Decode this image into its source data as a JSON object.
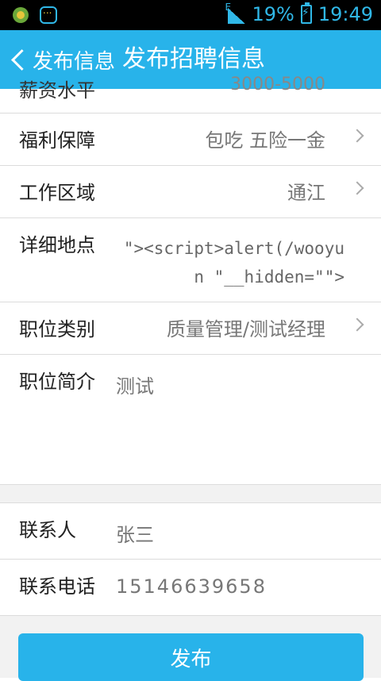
{
  "status_bar": {
    "network": "E",
    "battery": "19%",
    "time": "19:49"
  },
  "header": {
    "back_label": "发布信息",
    "title": "发布招聘信息"
  },
  "partial_row": {
    "label": "薪资水平",
    "value": "3000-5000"
  },
  "rows": {
    "welfare": {
      "label": "福利保障",
      "value": "包吃 五险一金"
    },
    "area": {
      "label": "工作区域",
      "value": "通江"
    },
    "address": {
      "label": "详细地点",
      "value": "\"><script>alert(/wooyun \"__hidden=\"\">"
    },
    "category": {
      "label": "职位类别",
      "value": "质量管理/测试经理"
    },
    "intro": {
      "label": "职位简介",
      "value": "测试"
    },
    "contact": {
      "label": "联系人",
      "value": "张三"
    },
    "phone": {
      "label": "联系电话",
      "value": "15146639658"
    }
  },
  "publish_button": "发布"
}
